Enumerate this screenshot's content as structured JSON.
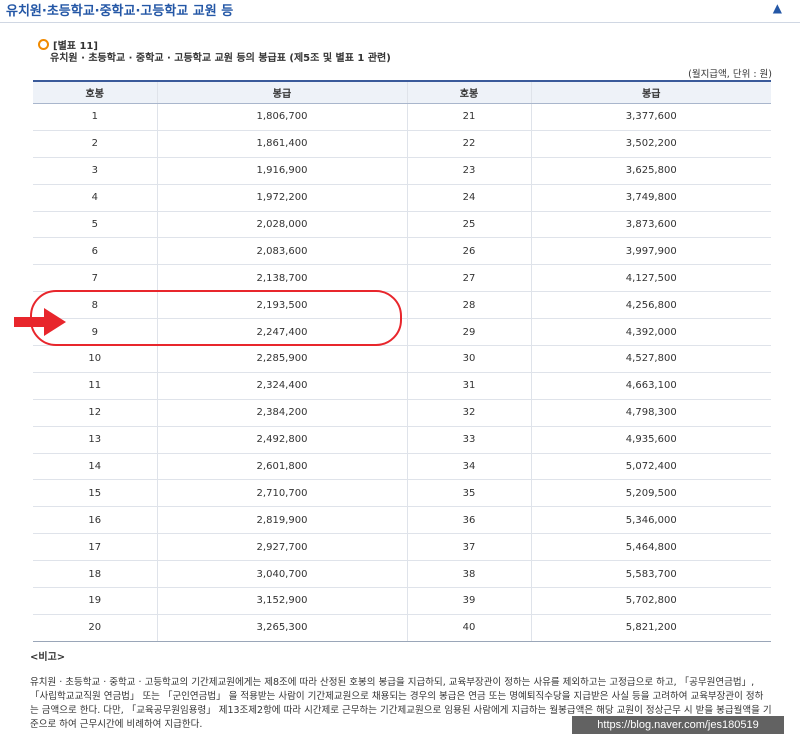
{
  "header": {
    "title": "유치원·초등학교·중학교·고등학교 교원 등",
    "up_arrow": "▲"
  },
  "table_label": {
    "code": "[별표 11]",
    "subtitle": "유치원 · 초등학교 · 중학교 · 고등학교 교원 등의 봉급표 (제5조 및 별표 1 관련)",
    "unit": "(월지급액, 단위 : 원)"
  },
  "table": {
    "headers": [
      "호봉",
      "봉급",
      "호봉",
      "봉급"
    ],
    "rows": [
      [
        "1",
        "1,806,700",
        "21",
        "3,377,600"
      ],
      [
        "2",
        "1,861,400",
        "22",
        "3,502,200"
      ],
      [
        "3",
        "1,916,900",
        "23",
        "3,625,800"
      ],
      [
        "4",
        "1,972,200",
        "24",
        "3,749,800"
      ],
      [
        "5",
        "2,028,000",
        "25",
        "3,873,600"
      ],
      [
        "6",
        "2,083,600",
        "26",
        "3,997,900"
      ],
      [
        "7",
        "2,138,700",
        "27",
        "4,127,500"
      ],
      [
        "8",
        "2,193,500",
        "28",
        "4,256,800"
      ],
      [
        "9",
        "2,247,400",
        "29",
        "4,392,000"
      ],
      [
        "10",
        "2,285,900",
        "30",
        "4,527,800"
      ],
      [
        "11",
        "2,324,400",
        "31",
        "4,663,100"
      ],
      [
        "12",
        "2,384,200",
        "32",
        "4,798,300"
      ],
      [
        "13",
        "2,492,800",
        "33",
        "4,935,600"
      ],
      [
        "14",
        "2,601,800",
        "34",
        "5,072,400"
      ],
      [
        "15",
        "2,710,700",
        "35",
        "5,209,500"
      ],
      [
        "16",
        "2,819,900",
        "36",
        "5,346,000"
      ],
      [
        "17",
        "2,927,700",
        "37",
        "5,464,800"
      ],
      [
        "18",
        "3,040,700",
        "38",
        "5,583,700"
      ],
      [
        "19",
        "3,152,900",
        "39",
        "5,702,800"
      ],
      [
        "20",
        "3,265,300",
        "40",
        "5,821,200"
      ]
    ]
  },
  "notes": {
    "heading": "<비고>",
    "body": "유치원 · 초등학교 · 중학교 · 고등학교의 기간제교원에게는 제8조에 따라 산정된 호봉의 봉급을 지급하되, 교육부장관이 정하는 사유를 제외하고는 고정급으로 하고, 「공무원연금법」, 「사립학교교직원 연금법」 또는 「군인연금법」 을 적용받는 사람이 기간제교원으로 채용되는 경우의 봉급은 연금 또는 명예퇴직수당을 지급받은 사실 등을 고려하여 교육부장관이 정하는 금액으로 한다. 다만, 「교육공무원임용령」 제13조제2항에 따라 시간제로 근무하는 기간제교원으로 임용된 사람에게 지급하는 월봉급액은 해당 교원이 정상근무 시 받을 봉급월액을 기준으로 하여 근무시간에 비례하여 지급한다."
  },
  "watermark": "https://blog.naver.com/jes180519",
  "colors": {
    "header_blue": "#2457a6",
    "highlight_red": "#e8262c",
    "label_orange": "#f08a00"
  }
}
